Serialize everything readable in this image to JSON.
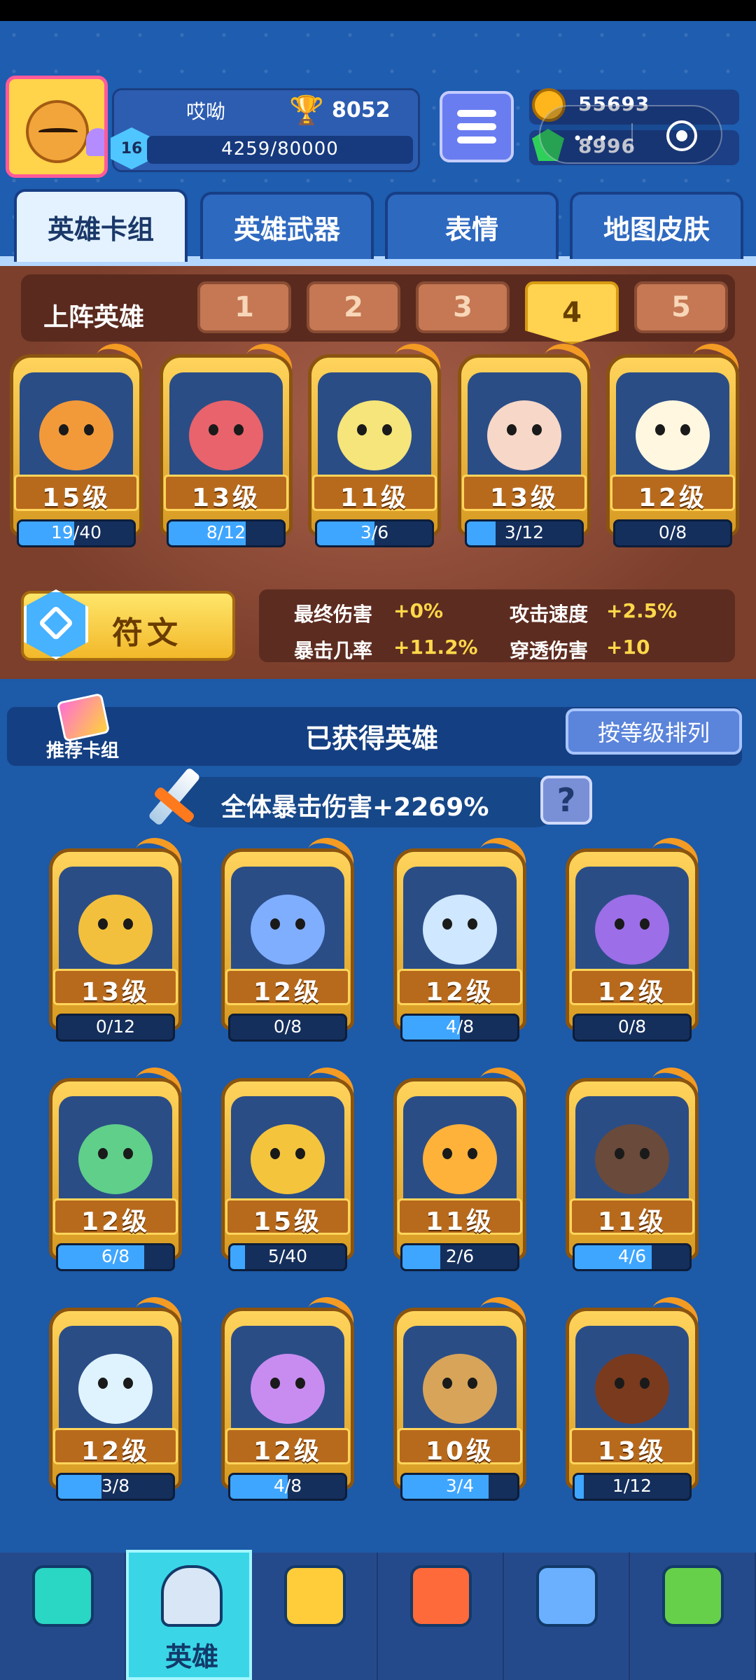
{
  "profile": {
    "name": "哎呦",
    "level": "16",
    "trophies": "8052",
    "xp": "4259/80000"
  },
  "currency": {
    "coins": "55693",
    "gems": "8996"
  },
  "tabs": [
    {
      "label": "英雄卡组"
    },
    {
      "label": "英雄武器"
    },
    {
      "label": "表情"
    },
    {
      "label": "地图皮肤"
    }
  ],
  "lineup": {
    "label": "上阵英雄",
    "deck_tabs": [
      "1",
      "2",
      "3",
      "4",
      "5"
    ],
    "active_deck": "4",
    "heroes": [
      {
        "level": "15级",
        "progress": "19/40",
        "fraction": 0.475,
        "color": "#f29a3a"
      },
      {
        "level": "13级",
        "progress": "8/12",
        "fraction": 0.67,
        "color": "#e8636b"
      },
      {
        "level": "11级",
        "progress": "3/6",
        "fraction": 0.5,
        "color": "#f5e57a"
      },
      {
        "level": "13级",
        "progress": "3/12",
        "fraction": 0.25,
        "color": "#f7d7c7"
      },
      {
        "level": "12级",
        "progress": "0/8",
        "fraction": 0.0,
        "color": "#fff7e0"
      }
    ]
  },
  "rune": {
    "label": "符文"
  },
  "stats": [
    {
      "label": "最终伤害",
      "value": "+0%"
    },
    {
      "label": "攻击速度",
      "value": "+2.5%"
    },
    {
      "label": "暴击几率",
      "value": "+11.2%"
    },
    {
      "label": "穿透伤害",
      "value": "+10"
    }
  ],
  "owned": {
    "recommend_label": "推荐卡组",
    "title": "已获得英雄",
    "sort_label": "按等级排列",
    "crit_text": "全体暴击伤害+2269%",
    "help_label": "?",
    "heroes": [
      {
        "level": "13级",
        "progress": "0/12",
        "fraction": 0.0,
        "color": "#f2c03c"
      },
      {
        "level": "12级",
        "progress": "0/8",
        "fraction": 0.0,
        "color": "#7faeff"
      },
      {
        "level": "12级",
        "progress": "4/8",
        "fraction": 0.5,
        "color": "#cfe7ff"
      },
      {
        "level": "12级",
        "progress": "0/8",
        "fraction": 0.0,
        "color": "#9c6ee8"
      },
      {
        "level": "12级",
        "progress": "6/8",
        "fraction": 0.75,
        "color": "#5fcf8a"
      },
      {
        "level": "15级",
        "progress": "5/40",
        "fraction": 0.125,
        "color": "#f4c43c"
      },
      {
        "level": "11级",
        "progress": "2/6",
        "fraction": 0.333,
        "color": "#ffb23a"
      },
      {
        "level": "11级",
        "progress": "4/6",
        "fraction": 0.667,
        "color": "#6a4a3a"
      },
      {
        "level": "12级",
        "progress": "3/8",
        "fraction": 0.375,
        "color": "#dff3ff"
      },
      {
        "level": "12级",
        "progress": "4/8",
        "fraction": 0.5,
        "color": "#c88cf0"
      },
      {
        "level": "10级",
        "progress": "3/4",
        "fraction": 0.75,
        "color": "#d7a45a"
      },
      {
        "level": "13级",
        "progress": "1/12",
        "fraction": 0.083,
        "color": "#7a3a1e"
      }
    ]
  },
  "nav": [
    {
      "icon": "treasure-chest-icon",
      "label": ""
    },
    {
      "icon": "knight-helmet-icon",
      "label": "英雄"
    },
    {
      "icon": "crossed-swords-icon",
      "label": ""
    },
    {
      "icon": "crown-shield-icon",
      "label": ""
    },
    {
      "icon": "team-banner-icon",
      "label": ""
    },
    {
      "icon": "sprout-island-icon",
      "label": ""
    }
  ]
}
